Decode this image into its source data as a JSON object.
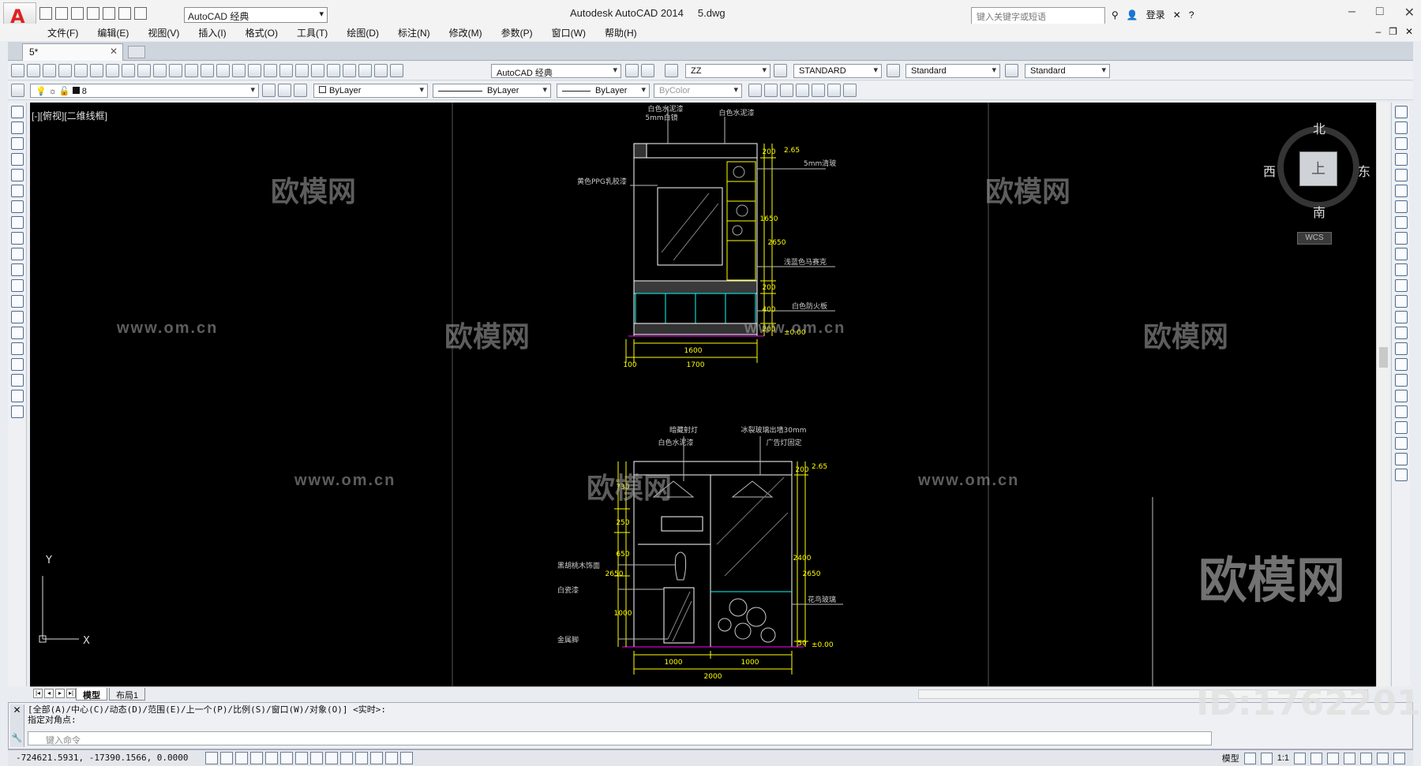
{
  "app": {
    "title": "Autodesk AutoCAD 2014",
    "filename": "5.dwg",
    "workspace": "AutoCAD 经典",
    "search_placeholder": "键入关键字或短语",
    "login": "登录",
    "watermark_brand": "欧模网",
    "watermark_url": "www.om.cn",
    "watermark_id": "ID:1762201"
  },
  "menu": [
    "文件(F)",
    "编辑(E)",
    "视图(V)",
    "插入(I)",
    "格式(O)",
    "工具(T)",
    "绘图(D)",
    "标注(N)",
    "修改(M)",
    "参数(P)",
    "窗口(W)",
    "帮助(H)"
  ],
  "doc_tab": {
    "label": "5*"
  },
  "toolbar1": {
    "workspace_combo": "AutoCAD 经典",
    "text_style": "ZZ",
    "dim_style": "STANDARD",
    "table_style": "Standard",
    "multileader_style": "Standard"
  },
  "toolbar2": {
    "layer": "8",
    "color": "ByLayer",
    "linetype": "ByLayer",
    "lineweight": "ByLayer",
    "plotstyle": "ByColor"
  },
  "viewport": {
    "label": "[-][俯视][二维线框]"
  },
  "viewcube": {
    "north": "北",
    "south": "南",
    "east": "东",
    "west": "西",
    "face": "上",
    "wcs": "WCS"
  },
  "drawing": {
    "upper": {
      "labels": {
        "top1": "白色水泥漆",
        "top2": "5mm白镜",
        "top3": "白色水泥漆",
        "left1": "黄色PPG乳胶漆",
        "right1": "5mm清玻",
        "right2": "浅蓝色马赛克",
        "right3": "白色防火板",
        "level": "±0.00",
        "level_top": "2.65"
      },
      "dims": {
        "w1": "1600",
        "w2": "1700",
        "w3": "100",
        "h1": "200",
        "h2": "1650",
        "h3": "2650",
        "h4": "200",
        "h5": "400",
        "h6": "200"
      }
    },
    "lower": {
      "labels": {
        "top1": "暗藏射灯",
        "top2": "白色水泥漆",
        "top3": "冰裂玻璃出墙30mm",
        "top4": "广告灯固定",
        "left1": "黑胡桃木饰面",
        "left2": "白瓷漆",
        "left3": "金属脚",
        "right1": "花鸟玻璃",
        "level": "±0.00",
        "level_top": "2.65"
      },
      "dims": {
        "w1": "1000",
        "w2": "1000",
        "w3": "2000",
        "h1": "730",
        "h2": "250",
        "h3": "650",
        "h4": "1000",
        "h5": "2650",
        "h6": "200",
        "h7": "2400",
        "h8": "50"
      }
    }
  },
  "ucs": {
    "x": "X",
    "y": "Y"
  },
  "layout_tabs": [
    "模型",
    "布局1"
  ],
  "command": {
    "history1": "[全部(A)/中心(C)/动态(D)/范围(E)/上一个(P)/比例(S)/窗口(W)/对象(O)] <实时>:",
    "history2": "指定对角点:",
    "placeholder": "键入命令"
  },
  "status": {
    "coords": "-724621.5931, -17390.1566, 0.0000",
    "model": "模型",
    "scale": "1:1"
  },
  "colors": {
    "canvas": "#000000",
    "drawing_line": "#ffffff",
    "dimension": "#ffff00",
    "furniture": "#00ffff",
    "floor": "#ff00ff",
    "accent_red": "#cc2222"
  }
}
